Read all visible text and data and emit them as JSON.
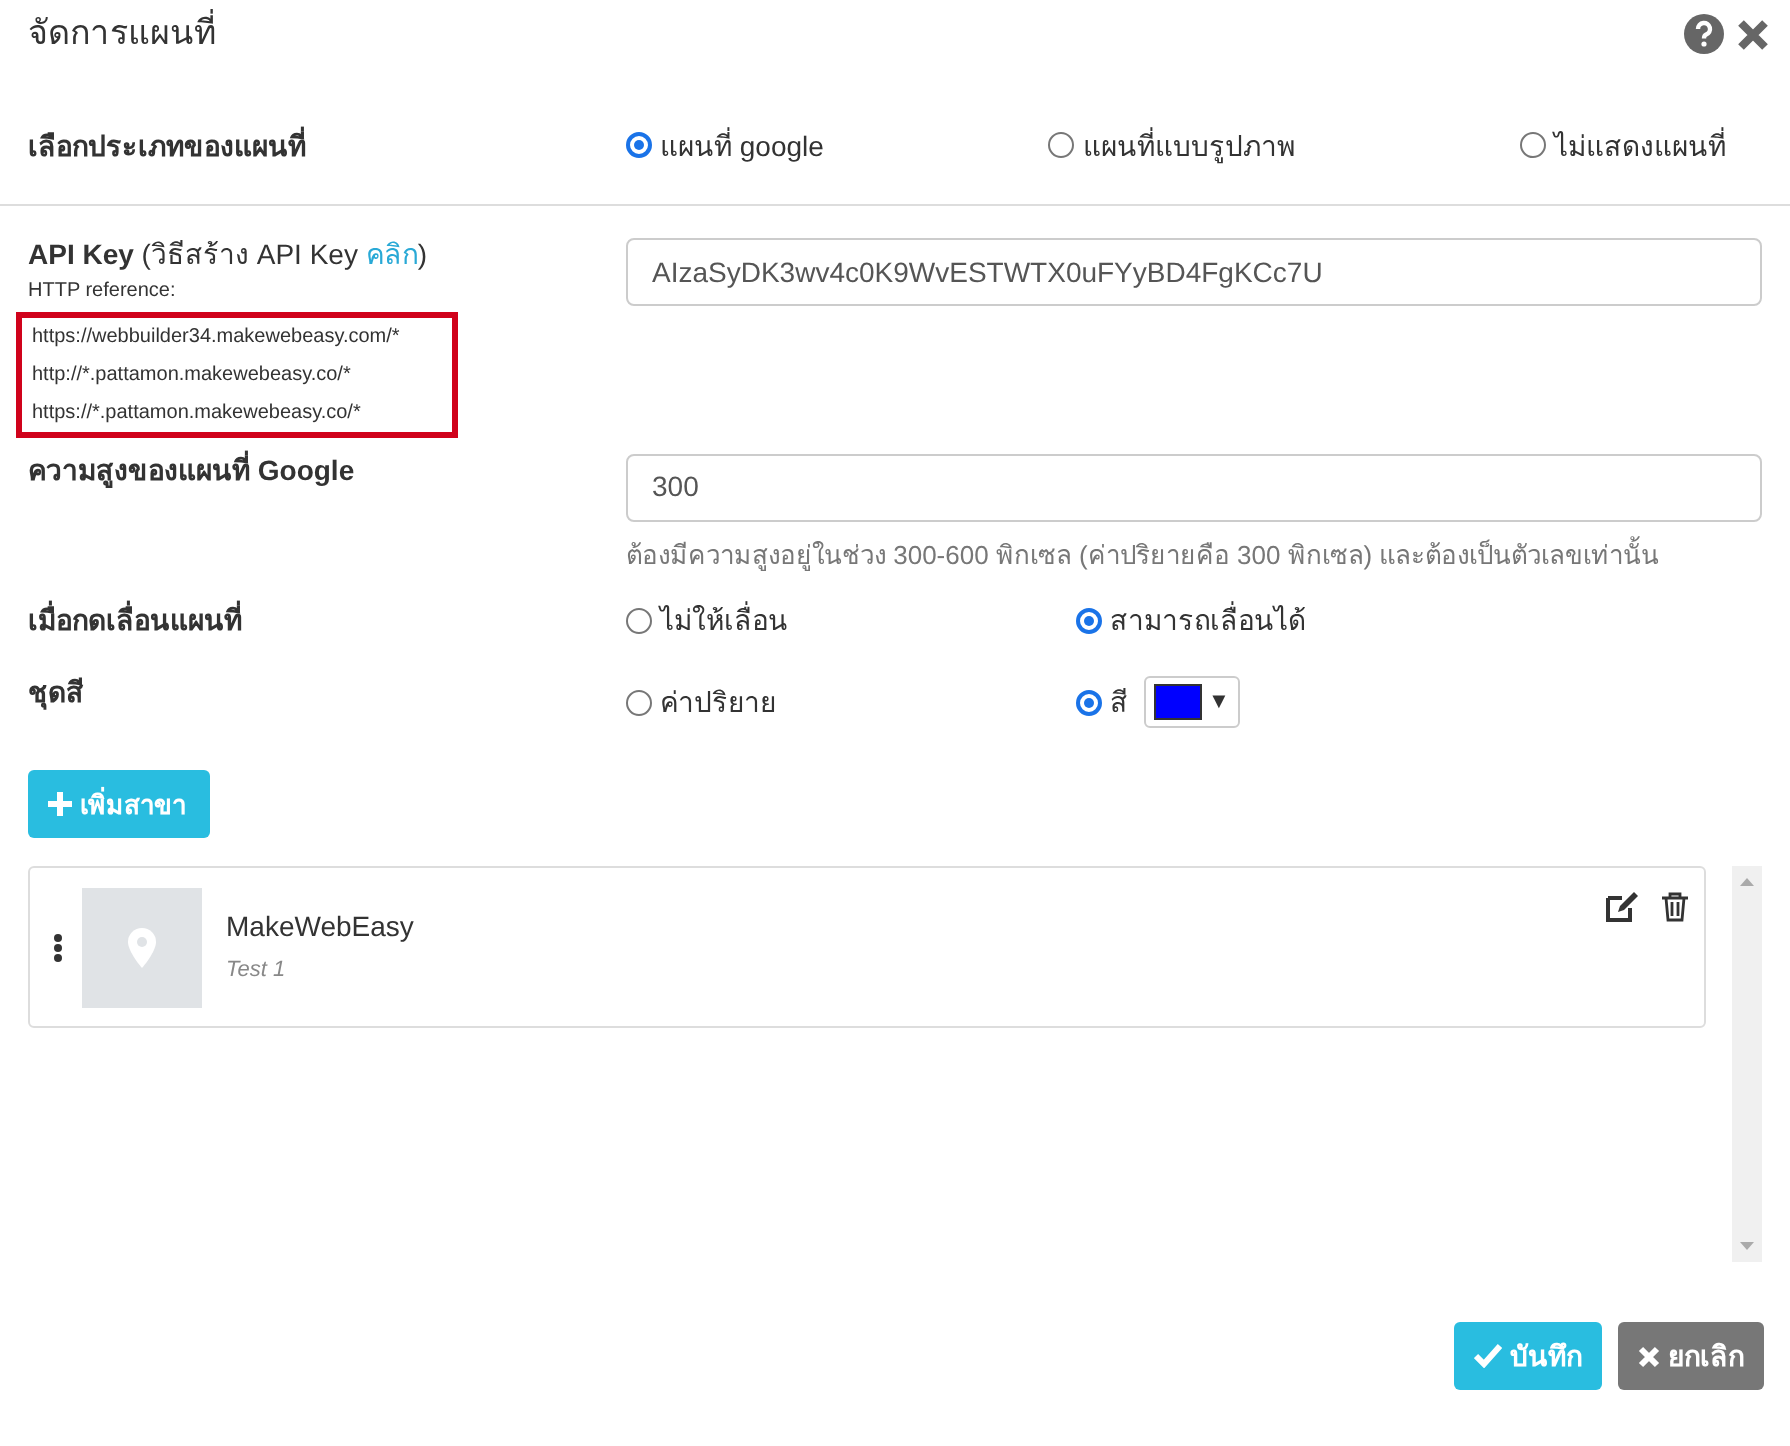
{
  "dialog": {
    "title": "จัดการแผนที่"
  },
  "map_type": {
    "label": "เลือกประเภทของแผนที่",
    "options": [
      {
        "label": "แผนที่ google",
        "selected": true
      },
      {
        "label": "แผนที่แบบรูปภาพ",
        "selected": false
      },
      {
        "label": "ไม่แสดงแผนที่",
        "selected": false
      }
    ]
  },
  "api_key": {
    "label": "**API Key** (วิธีสร้าง API Key ",
    "link": "คลิก",
    "label_end": ")",
    "reference_label": "HTTP reference:",
    "references": [
      "https://webbuilder34.makewebeasy.com/*",
      "http://*.pattamon.makewebeasy.co/*",
      "https://*.pattamon.makewebeasy.co/*"
    ],
    "value": "AIzaSyDK3wv4c0K9WvESTWTX0uFYyBD4FgKCc7U"
  },
  "map_height": {
    "label": "ความสูงของแผนที่ Google",
    "value": "300",
    "help": "ต้องมีความสูงอยู่ในช่วง 300-600 พิกเซล (ค่าปริยายคือ 300 พิกเซล) และต้องเป็นตัวเลขเท่านั้น"
  },
  "map_drag": {
    "label": "เมื่อกดเลื่อนแผนที่",
    "options": [
      {
        "label": "ไม่ให้เลื่อน",
        "selected": false
      },
      {
        "label": "สามารถเลื่อนได้",
        "selected": true
      }
    ]
  },
  "color_set": {
    "label": "ชุดสี",
    "options": [
      {
        "label": "ค่าปริยาย",
        "selected": false
      },
      {
        "label": "สี",
        "selected": true,
        "color": "#0000ff",
        "caret": "▼"
      }
    ]
  },
  "add_branch": {
    "label": "เพิ่มสาขา"
  },
  "branches": [
    {
      "name": "MakeWebEasy",
      "description": "Test 1"
    }
  ],
  "footer_buttons": [
    {
      "label": "บันทึก",
      "kind": "save"
    },
    {
      "label": "ยกเลิก",
      "kind": "cancel"
    }
  ]
}
